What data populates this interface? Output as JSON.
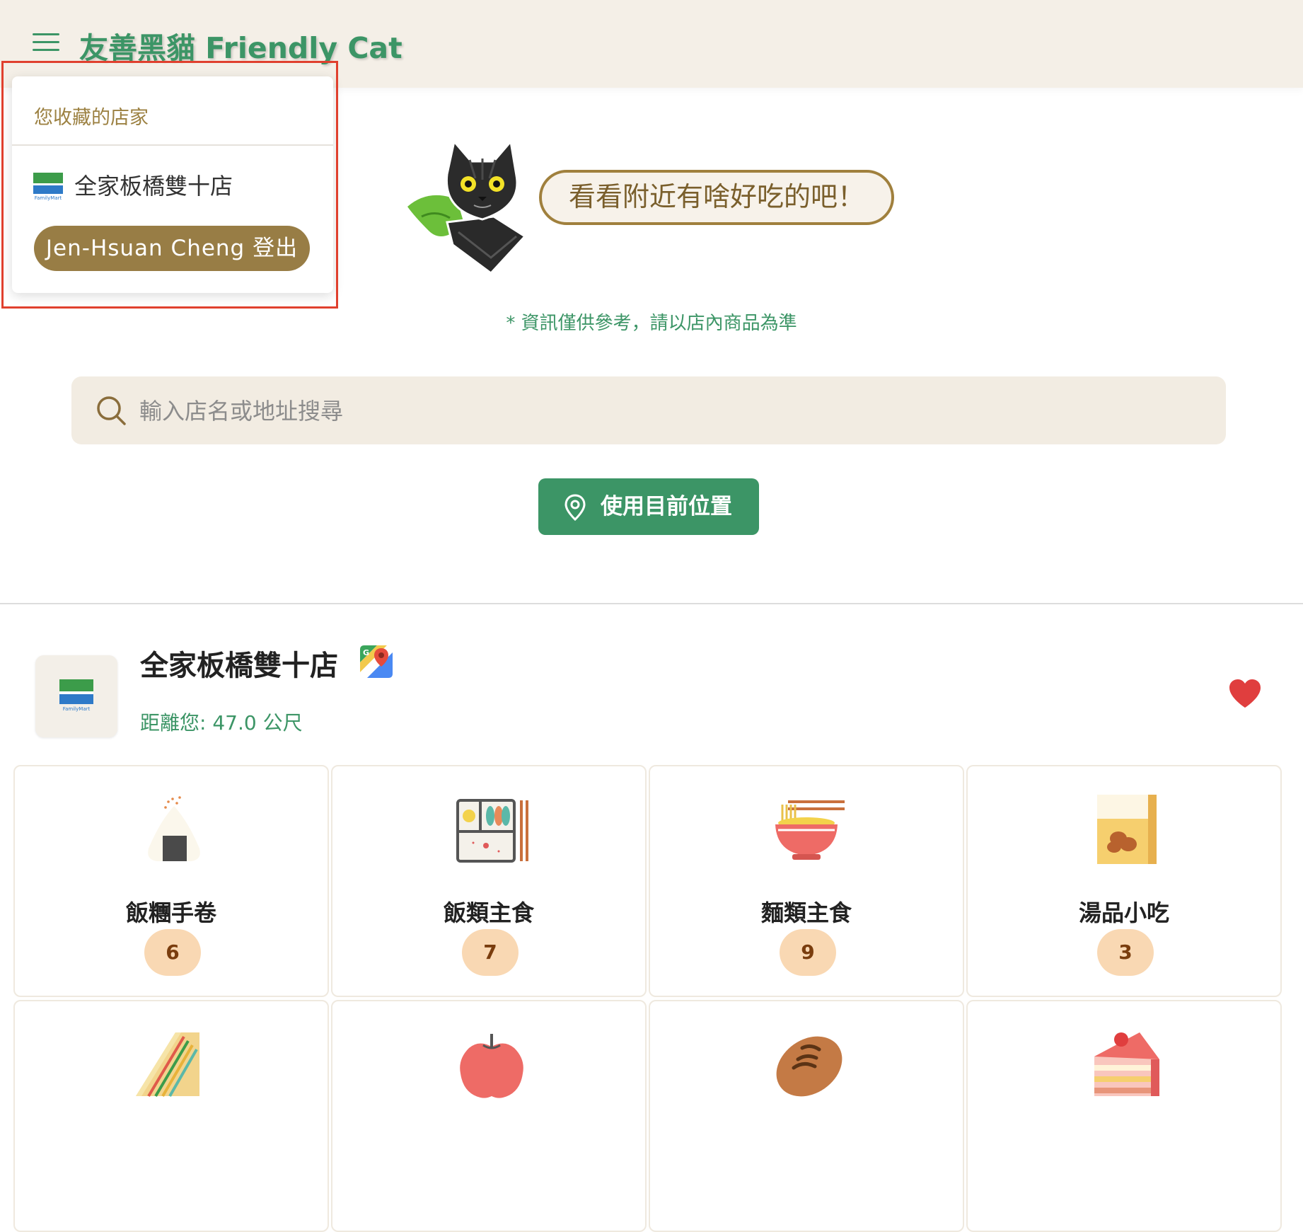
{
  "header": {
    "app_title": "友善黑貓 Friendly Cat"
  },
  "dropdown": {
    "heading": "您收藏的店家",
    "favorites": [
      {
        "name": "全家板橋雙十店"
      }
    ],
    "logout_label": "Jen-Hsuan Cheng 登出",
    "logo_text": "FamilyMart"
  },
  "hero": {
    "speech": "看看附近有啥好吃的吧！",
    "disclaimer": "* 資訊僅供參考，請以店內商品為準"
  },
  "search": {
    "placeholder": "輸入店名或地址搜尋"
  },
  "location_button": {
    "label": "使用目前位置"
  },
  "store": {
    "name": "全家板橋雙十店",
    "distance": "距離您: 47.0 公尺",
    "favorited": true,
    "logo_text": "FamilyMart"
  },
  "categories": [
    {
      "label": "飯糰手卷",
      "count": "6",
      "icon": "onigiri-icon"
    },
    {
      "label": "飯類主食",
      "count": "7",
      "icon": "bento-icon"
    },
    {
      "label": "麵類主食",
      "count": "9",
      "icon": "noodle-bowl-icon"
    },
    {
      "label": "湯品小吃",
      "count": "3",
      "icon": "snack-bag-icon"
    },
    {
      "label": "",
      "count": "",
      "icon": "sandwich-icon"
    },
    {
      "label": "",
      "count": "",
      "icon": "apple-icon"
    },
    {
      "label": "",
      "count": "",
      "icon": "bread-icon"
    },
    {
      "label": "",
      "count": "",
      "icon": "cake-icon"
    }
  ],
  "colors": {
    "brand_green": "#3c9566",
    "brand_brown": "#987d45",
    "header_bg": "#f4efe7",
    "heart_red": "#e03e3e",
    "count_badge": "#f9d8b3"
  }
}
